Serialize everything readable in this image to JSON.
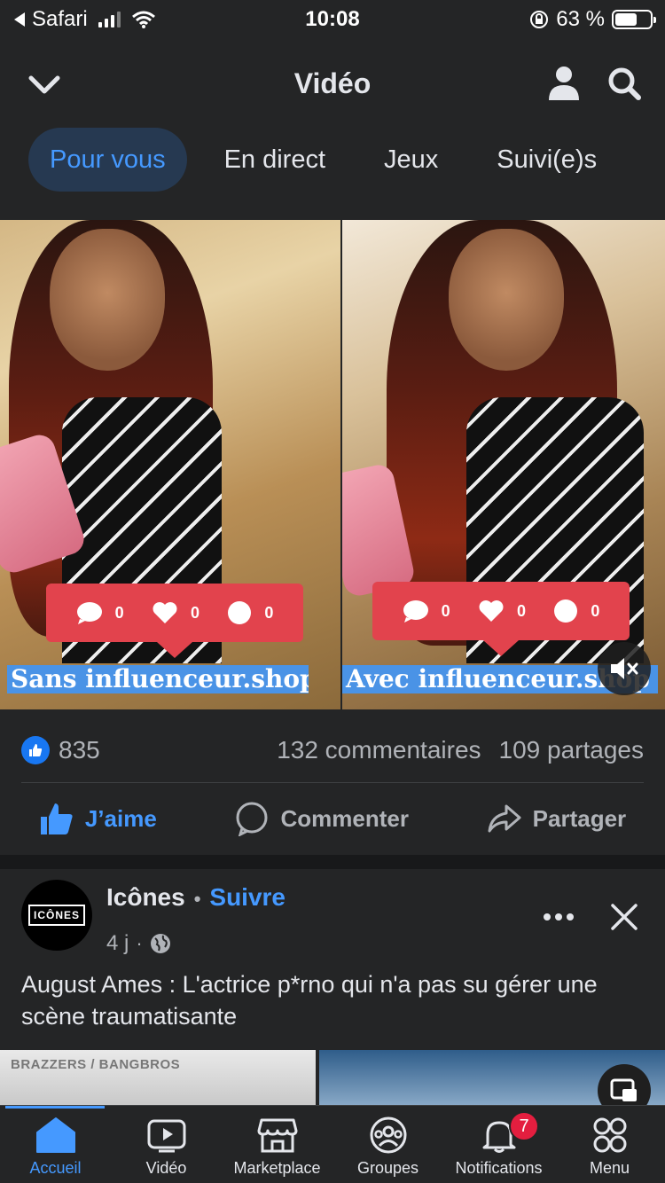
{
  "status_bar": {
    "back_app": "Safari",
    "time": "10:08",
    "battery_percent": "63 %",
    "battery_level": 0.63
  },
  "header": {
    "title": "Vidéo",
    "back_icon": "chevron-down-icon",
    "profile_icon": "person-icon",
    "search_icon": "search-icon"
  },
  "tabs": [
    {
      "label": "Pour vous",
      "active": true
    },
    {
      "label": "En direct",
      "active": false
    },
    {
      "label": "Jeux",
      "active": false
    },
    {
      "label": "Suivi(e)s",
      "active": false
    }
  ],
  "video": {
    "left_counts": [
      "0",
      "0",
      "0"
    ],
    "right_counts": [
      "0",
      "0",
      "0"
    ],
    "left_caption": "Sans influenceur.shop",
    "right_caption": "Avec influenceur.shop"
  },
  "reactions": {
    "likes": "835",
    "comments": "132 commentaires",
    "shares": "109 partages"
  },
  "actions": {
    "like": "J’aime",
    "comment": "Commenter",
    "share": "Partager"
  },
  "post2": {
    "avatar_text": "ICÔNES",
    "author": "Icônes",
    "follow": "Suivre",
    "time": "4 j",
    "text": "August Ames : L'actrice p*rno qui n'a pas su gérer une scène traumatisante",
    "preview_tag": "BRAZZERS / BANGBROS"
  },
  "bottom_nav": [
    {
      "label": "Accueil",
      "icon": "home-icon",
      "active": true
    },
    {
      "label": "Vidéo",
      "icon": "video-icon",
      "active": false
    },
    {
      "label": "Marketplace",
      "icon": "marketplace-icon",
      "active": false
    },
    {
      "label": "Groupes",
      "icon": "groups-icon",
      "active": false
    },
    {
      "label": "Notifications",
      "icon": "bell-icon",
      "active": false,
      "badge": "7"
    },
    {
      "label": "Menu",
      "icon": "menu-grid-icon",
      "active": false
    }
  ],
  "colors": {
    "accent": "#4599ff",
    "background": "#242526",
    "badge": "#e41e3f"
  }
}
